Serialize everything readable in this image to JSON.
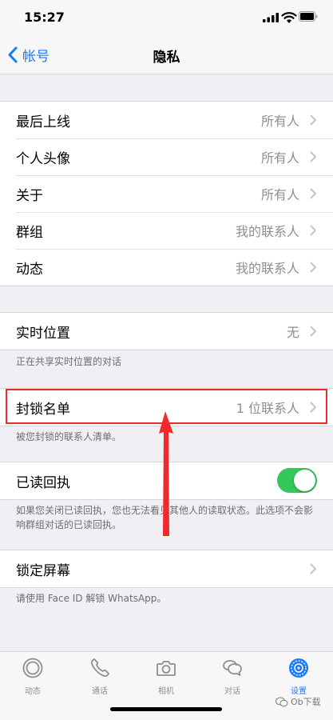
{
  "status_bar": {
    "time": "15:27"
  },
  "nav": {
    "back_label": "帐号",
    "title": "隐私"
  },
  "privacy_items": [
    {
      "label": "最后上线",
      "value": "所有人"
    },
    {
      "label": "个人头像",
      "value": "所有人"
    },
    {
      "label": "关于",
      "value": "所有人"
    },
    {
      "label": "群组",
      "value": "我的联系人"
    },
    {
      "label": "动态",
      "value": "我的联系人"
    }
  ],
  "live_location": {
    "label": "实时位置",
    "value": "无",
    "footnote": "正在共享实时位置的对话"
  },
  "blocked": {
    "label": "封锁名单",
    "value": "1 位联系人",
    "footnote": "被您封锁的联系人清单。"
  },
  "read_receipts": {
    "label": "已读回执",
    "enabled": true,
    "footnote": "如果您关闭已读回执，您也无法看见其他人的读取状态。此选项不会影响群组对话的已读回执。"
  },
  "screen_lock": {
    "label": "锁定屏幕",
    "footnote": "请使用 Face ID 解锁 WhatsApp。"
  },
  "tabs": [
    {
      "label": "动态",
      "icon": "status-icon"
    },
    {
      "label": "通话",
      "icon": "phone-icon"
    },
    {
      "label": "相机",
      "icon": "camera-icon"
    },
    {
      "label": "对话",
      "icon": "chats-icon"
    },
    {
      "label": "设置",
      "icon": "gear-icon",
      "active": true
    }
  ],
  "watermark": "Ob下载",
  "colors": {
    "accent": "#1b7cf5",
    "toggle_on": "#34c759",
    "highlight": "#f02a2a"
  }
}
